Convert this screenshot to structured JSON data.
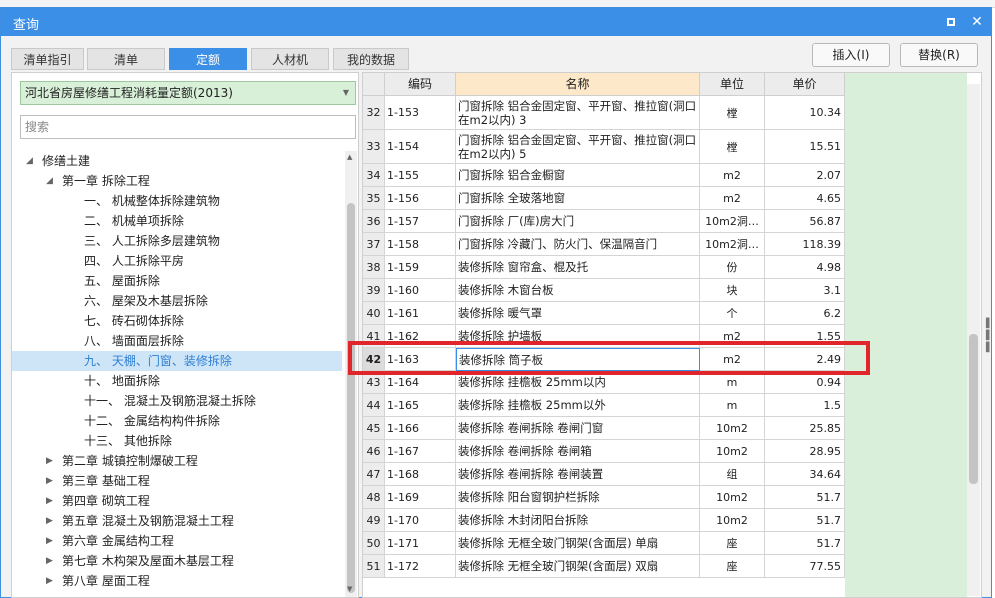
{
  "window": {
    "title": "查询"
  },
  "tabs": [
    {
      "label": "清单指引",
      "active": false
    },
    {
      "label": "清单",
      "active": false
    },
    {
      "label": "定额",
      "active": true
    },
    {
      "label": "人材机",
      "active": false
    },
    {
      "label": "我的数据",
      "active": false
    }
  ],
  "actions": {
    "insert": "插入(I)",
    "replace": "替换(R)"
  },
  "library": {
    "selected": "河北省房屋修缮工程消耗量定额(2013)"
  },
  "search": {
    "placeholder": "搜索"
  },
  "tree": [
    {
      "label": "修缮土建",
      "level": 0,
      "toggle": "◢",
      "selected": false
    },
    {
      "label": "第一章 拆除工程",
      "level": 1,
      "toggle": "◢",
      "selected": false
    },
    {
      "label": "一、 机械整体拆除建筑物",
      "level": 2,
      "toggle": "",
      "selected": false
    },
    {
      "label": "二、 机械单项拆除",
      "level": 2,
      "toggle": "",
      "selected": false
    },
    {
      "label": "三、 人工拆除多层建筑物",
      "level": 2,
      "toggle": "",
      "selected": false
    },
    {
      "label": "四、 人工拆除平房",
      "level": 2,
      "toggle": "",
      "selected": false
    },
    {
      "label": "五、 屋面拆除",
      "level": 2,
      "toggle": "",
      "selected": false
    },
    {
      "label": "六、 屋架及木基层拆除",
      "level": 2,
      "toggle": "",
      "selected": false
    },
    {
      "label": "七、 砖石砌体拆除",
      "level": 2,
      "toggle": "",
      "selected": false
    },
    {
      "label": "八、 墙面面层拆除",
      "level": 2,
      "toggle": "",
      "selected": false
    },
    {
      "label": "九、 天棚、门窗、装修拆除",
      "level": 2,
      "toggle": "",
      "selected": true
    },
    {
      "label": "十、 地面拆除",
      "level": 2,
      "toggle": "",
      "selected": false
    },
    {
      "label": "十一、 混凝土及钢筋混凝土拆除",
      "level": 2,
      "toggle": "",
      "selected": false
    },
    {
      "label": "十二、 金属结构构件拆除",
      "level": 2,
      "toggle": "",
      "selected": false
    },
    {
      "label": "十三、 其他拆除",
      "level": 2,
      "toggle": "",
      "selected": false
    },
    {
      "label": "第二章 城镇控制爆破工程",
      "level": 1,
      "toggle": "▶",
      "selected": false
    },
    {
      "label": "第三章 基础工程",
      "level": 1,
      "toggle": "▶",
      "selected": false
    },
    {
      "label": "第四章 砌筑工程",
      "level": 1,
      "toggle": "▶",
      "selected": false
    },
    {
      "label": "第五章 混凝土及钢筋混凝土工程",
      "level": 1,
      "toggle": "▶",
      "selected": false
    },
    {
      "label": "第六章 金属结构工程",
      "level": 1,
      "toggle": "▶",
      "selected": false
    },
    {
      "label": "第七章 木构架及屋面木基层工程",
      "level": 1,
      "toggle": "▶",
      "selected": false
    },
    {
      "label": "第八章 屋面工程",
      "level": 1,
      "toggle": "▶",
      "selected": false
    }
  ],
  "grid": {
    "columns": {
      "code": "编码",
      "name": "名称",
      "unit": "单位",
      "price": "单价"
    },
    "rows": [
      {
        "idx": "32",
        "code": "1-153",
        "name": "门窗拆除 铝合金固定窗、平开窗、推拉窗(洞口在m2以内) 3",
        "unit": "樘",
        "price": "10.34"
      },
      {
        "idx": "33",
        "code": "1-154",
        "name": "门窗拆除 铝合金固定窗、平开窗、推拉窗(洞口在m2以内) 5",
        "unit": "樘",
        "price": "15.51"
      },
      {
        "idx": "34",
        "code": "1-155",
        "name": "门窗拆除 铝合金橱窗",
        "unit": "m2",
        "price": "2.07"
      },
      {
        "idx": "35",
        "code": "1-156",
        "name": "门窗拆除 全玻落地窗",
        "unit": "m2",
        "price": "4.65"
      },
      {
        "idx": "36",
        "code": "1-157",
        "name": "门窗拆除 厂(库)房大门",
        "unit": "10m2洞…",
        "price": "56.87"
      },
      {
        "idx": "37",
        "code": "1-158",
        "name": "门窗拆除 冷藏门、防火门、保温隔音门",
        "unit": "10m2洞…",
        "price": "118.39"
      },
      {
        "idx": "38",
        "code": "1-159",
        "name": "装修拆除 窗帘盒、棍及托",
        "unit": "份",
        "price": "4.98"
      },
      {
        "idx": "39",
        "code": "1-160",
        "name": "装修拆除 木窗台板",
        "unit": "块",
        "price": "3.1"
      },
      {
        "idx": "40",
        "code": "1-161",
        "name": "装修拆除 暖气罩",
        "unit": "个",
        "price": "6.2"
      },
      {
        "idx": "41",
        "code": "1-162",
        "name": "装修拆除 护墙板",
        "unit": "m2",
        "price": "1.55"
      },
      {
        "idx": "42",
        "code": "1-163",
        "name": "装修拆除 筒子板",
        "unit": "m2",
        "price": "2.49",
        "selected": true
      },
      {
        "idx": "43",
        "code": "1-164",
        "name": "装修拆除 挂檐板 25mm以内",
        "unit": "m",
        "price": "0.94"
      },
      {
        "idx": "44",
        "code": "1-165",
        "name": "装修拆除 挂檐板 25mm以外",
        "unit": "m",
        "price": "1.5"
      },
      {
        "idx": "45",
        "code": "1-166",
        "name": "装修拆除 卷闸拆除 卷闸门窗",
        "unit": "10m2",
        "price": "25.85"
      },
      {
        "idx": "46",
        "code": "1-167",
        "name": "装修拆除 卷闸拆除 卷闸箱",
        "unit": "10m2",
        "price": "28.95"
      },
      {
        "idx": "47",
        "code": "1-168",
        "name": "装修拆除 卷闸拆除 卷闸装置",
        "unit": "组",
        "price": "34.64"
      },
      {
        "idx": "48",
        "code": "1-169",
        "name": "装修拆除 阳台窗钢护栏拆除",
        "unit": "10m2",
        "price": "51.7"
      },
      {
        "idx": "49",
        "code": "1-170",
        "name": "装修拆除 木封闭阳台拆除",
        "unit": "10m2",
        "price": "51.7"
      },
      {
        "idx": "50",
        "code": "1-171",
        "name": "装修拆除 无框全玻门钢架(含面层) 单扇",
        "unit": "座",
        "price": "51.7"
      },
      {
        "idx": "51",
        "code": "1-172",
        "name": "装修拆除 无框全玻门钢架(含面层) 双扇",
        "unit": "座",
        "price": "77.55"
      }
    ]
  },
  "icons": {
    "maximize": "maximize-icon",
    "close": "close-icon"
  },
  "colors": {
    "accent": "#3c8fe6",
    "highlight": "#e0262a",
    "green": "#d9efd9"
  }
}
